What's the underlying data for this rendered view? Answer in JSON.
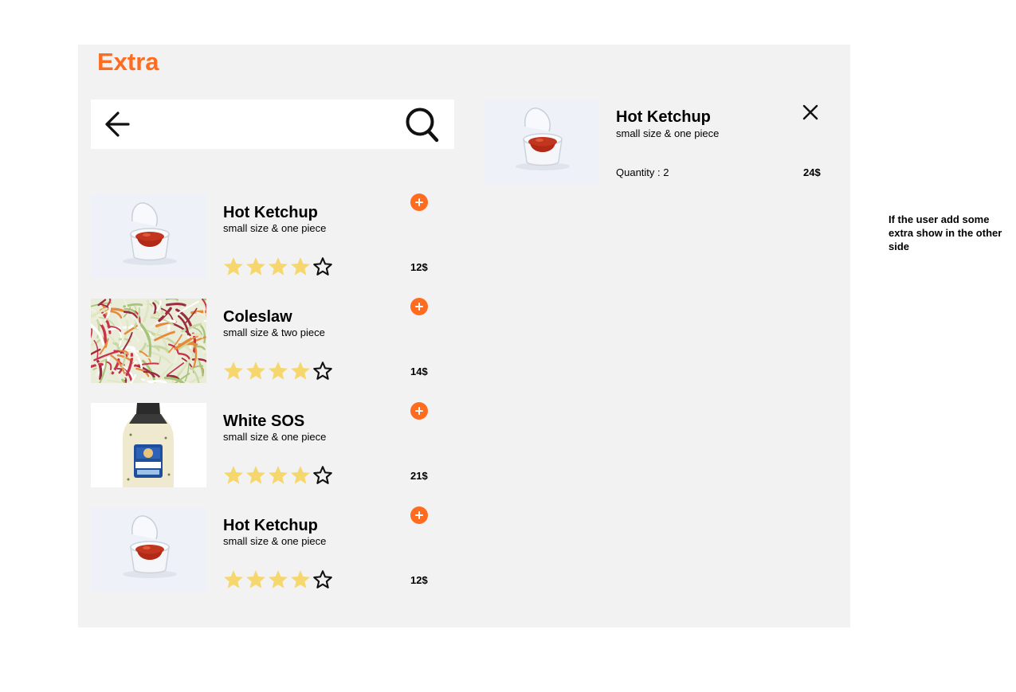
{
  "page": {
    "title": "Extra"
  },
  "search": {
    "placeholder": ""
  },
  "items": [
    {
      "name": "Hot Ketchup",
      "desc": "small size & one piece",
      "price": "12$",
      "rating": 4,
      "max_rating": 5,
      "image": "ketchup-cup"
    },
    {
      "name": "Coleslaw",
      "desc": "small size & two piece",
      "price": "14$",
      "rating": 4,
      "max_rating": 5,
      "image": "coleslaw"
    },
    {
      "name": "White SOS",
      "desc": "small size & one piece",
      "price": "21$",
      "rating": 4,
      "max_rating": 5,
      "image": "sauce-bottle"
    },
    {
      "name": "Hot Ketchup",
      "desc": "small size & one piece",
      "price": "12$",
      "rating": 4,
      "max_rating": 5,
      "image": "ketchup-cup"
    }
  ],
  "cart": {
    "name": "Hot Ketchup",
    "desc": "small size & one piece",
    "quantity_label": "Quantity :  2",
    "price": "24$"
  },
  "note": "If the user add some extra show in the other side",
  "colors": {
    "accent": "#ff6b1f",
    "star": "#f5d76e",
    "panel": "#f2f2f2"
  }
}
